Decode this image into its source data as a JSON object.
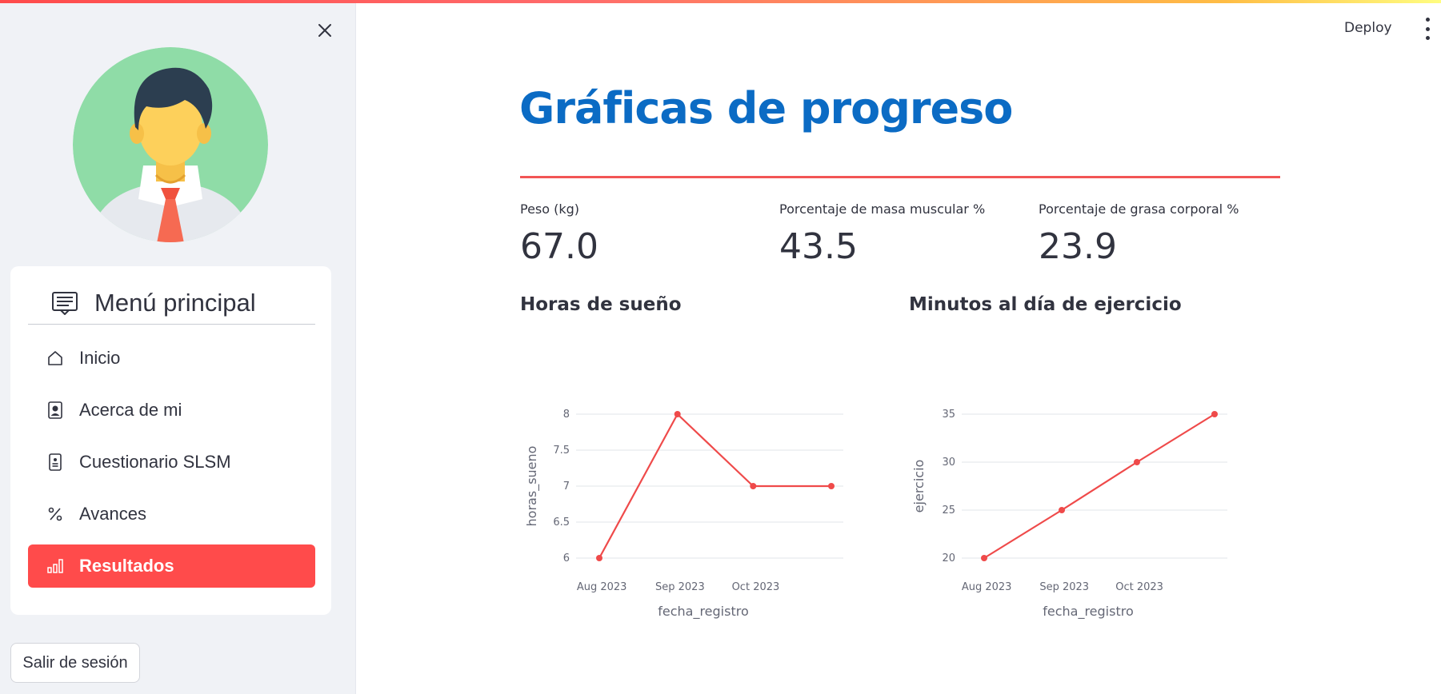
{
  "sidebar": {
    "menu": {
      "title": "Menú principal",
      "items": [
        {
          "label": "Inicio",
          "icon": "house-icon",
          "active": false
        },
        {
          "label": "Acerca de mi",
          "icon": "person-badge-icon",
          "active": false
        },
        {
          "label": "Cuestionario SLSM",
          "icon": "document-person-icon",
          "active": false
        },
        {
          "label": "Avances",
          "icon": "percent-icon",
          "active": false
        },
        {
          "label": "Resultados",
          "icon": "bar-chart-icon",
          "active": true
        }
      ]
    },
    "logout_label": "Salir de sesión"
  },
  "header": {
    "deploy_label": "Deploy"
  },
  "main": {
    "title": "Gráficas de progreso",
    "metrics": [
      {
        "label": "Peso (kg)",
        "value": "67.0"
      },
      {
        "label": "Porcentaje de masa muscular %",
        "value": "43.5"
      },
      {
        "label": "Porcentaje de grasa corporal %",
        "value": "23.9"
      }
    ],
    "chart_titles": [
      "Horas de sueño",
      "Minutos al día de ejercicio"
    ]
  },
  "colors": {
    "accent": "#ff4b4b",
    "title": "#0b6bc4",
    "line": "#ef4a4a",
    "grid": "#e2e4ea"
  },
  "chart_data": [
    {
      "type": "line",
      "title": "Horas de sueño",
      "xlabel": "fecha_registro",
      "ylabel": "horas_sueno",
      "x": [
        "2023-07-31",
        "2023-08-31",
        "2023-09-30",
        "2023-10-31"
      ],
      "y": [
        6,
        8,
        7,
        7
      ],
      "x_ticks": [
        "Aug 2023",
        "Sep 2023",
        "Oct 2023"
      ],
      "y_ticks": [
        "6",
        "6.5",
        "7",
        "7.5",
        "8"
      ],
      "ylim": [
        6,
        8
      ],
      "grid": true
    },
    {
      "type": "line",
      "title": "Minutos al día de ejercicio",
      "xlabel": "fecha_registro",
      "ylabel": "ejercicio",
      "x": [
        "2023-07-31",
        "2023-08-31",
        "2023-09-30",
        "2023-10-31"
      ],
      "y": [
        20,
        25,
        30,
        35
      ],
      "x_ticks": [
        "Aug 2023",
        "Sep 2023",
        "Oct 2023"
      ],
      "y_ticks": [
        "20",
        "25",
        "30",
        "35"
      ],
      "ylim": [
        20,
        35
      ],
      "grid": true
    }
  ]
}
